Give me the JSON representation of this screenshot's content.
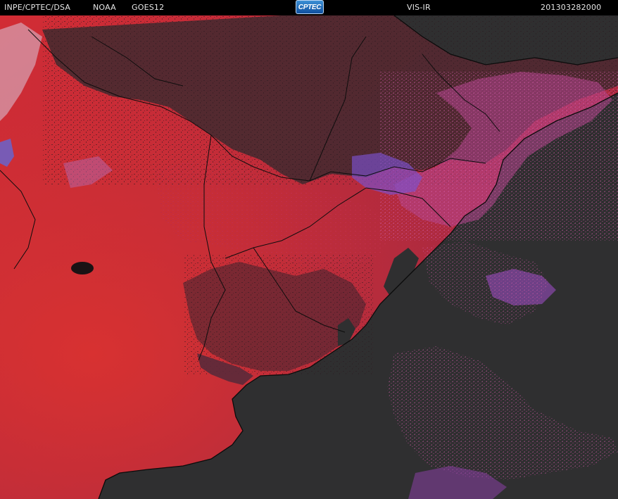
{
  "header": {
    "institution": "INPE/CPTEC/DSA",
    "agency": "NOAA",
    "satellite": "GOES12",
    "logo_text": "CPTEC",
    "channel": "VIS-IR",
    "timestamp": "201303282000"
  },
  "colors": {
    "background": "#000000",
    "land_warm": "#c9283a",
    "ocean": "#2e2e2f",
    "cloud_magenta": "#c04a9a",
    "cloud_violet": "#7a4ad0",
    "coastline": "#000000"
  },
  "icons": {
    "logo": "cptec-logo-icon"
  }
}
